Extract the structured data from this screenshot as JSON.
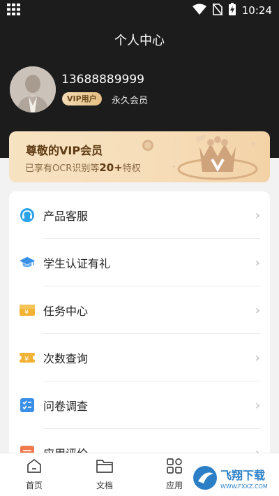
{
  "status_bar": {
    "time": "10:24"
  },
  "header": {
    "title": "个人中心"
  },
  "profile": {
    "phone": "13688889999",
    "vip_badge": "VIP用户",
    "member_type": "永久会员"
  },
  "vip_card": {
    "title": "尊敬的VIP会员",
    "subtitle_prefix": "已享有OCR识别等",
    "subtitle_highlight": "20+",
    "subtitle_suffix": "特权"
  },
  "menu": {
    "items": [
      {
        "label": "产品客服",
        "icon": "headset-icon",
        "color": "#2aa3e8"
      },
      {
        "label": "学生认证有礼",
        "icon": "graduation-cap-icon",
        "color": "#3a8fe6"
      },
      {
        "label": "任务中心",
        "icon": "ticket-icon",
        "color": "#f2b233"
      },
      {
        "label": "次数查询",
        "icon": "coupon-icon",
        "color": "#f2b233"
      },
      {
        "label": "问卷调查",
        "icon": "checklist-icon",
        "color": "#3a8fe6"
      },
      {
        "label": "应用评价",
        "icon": "rating-icon",
        "color": "#ef7a4d"
      }
    ]
  },
  "bottom_nav": {
    "items": [
      {
        "label": "首页",
        "icon": "home-icon"
      },
      {
        "label": "文档",
        "icon": "folder-icon"
      },
      {
        "label": "应用",
        "icon": "apps-icon"
      }
    ]
  },
  "watermark": {
    "text": "飞翔下载",
    "url_text": "WWW.FXXZ.COM"
  },
  "colors": {
    "header_bg": "#1d1c1d",
    "vip_gold": "#e6bf84",
    "page_bg": "#f2f2f2"
  }
}
